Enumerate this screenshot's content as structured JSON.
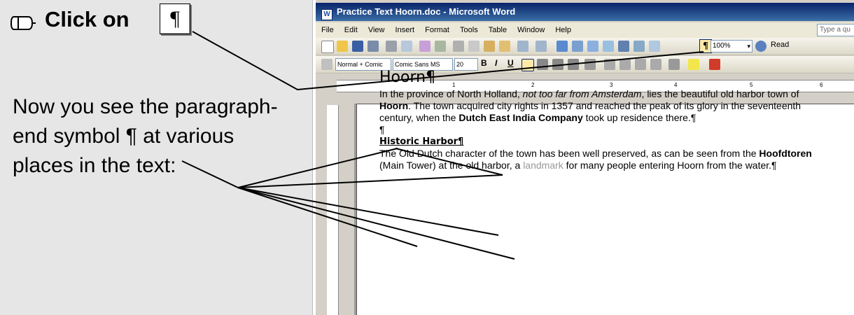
{
  "instruction": {
    "step_label": "Click on",
    "button_glyph": "¶",
    "explanation_lines": [
      "Now you see the paragraph-",
      "end symbol ¶ at various",
      "places in the text:"
    ]
  },
  "word": {
    "title": "Practice Text Hoorn.doc - Microsoft Word",
    "menu": [
      "File",
      "Edit",
      "View",
      "Insert",
      "Format",
      "Tools",
      "Table",
      "Window",
      "Help"
    ],
    "help_placeholder": "Type a qu",
    "zoom": "100%",
    "read_label": "Read",
    "show_hide_glyph": "¶",
    "style": "Normal + Comic",
    "font": "Comic Sans MS",
    "font_size": "20",
    "ruler_marks": [
      "1",
      "2",
      "3",
      "4",
      "5",
      "6"
    ]
  },
  "document": {
    "heading": "Hoorn¶",
    "p1": {
      "a": "In the province of North Holland, ",
      "b": "not too far from Amsterdam",
      "c": ", lies the beautiful old harbor town of ",
      "d": "Hoorn",
      "e": ". The town acquired city rights in 1357 and reached the peak of its glory in the seventeenth century, when the ",
      "f": "Dutch East India Company",
      "g": " took up residence there.¶"
    },
    "empty_para": "¶",
    "subheading": "Historic Harbor¶",
    "p2": {
      "a": "The Old Dutch character of the town has been well preserved, as can be seen from the ",
      "b": "Hoofdtoren",
      "c": " (Main Tower) at the old harbor, a ",
      "d": "landmark",
      "e": " for many people entering Hoorn from the water.¶"
    }
  }
}
